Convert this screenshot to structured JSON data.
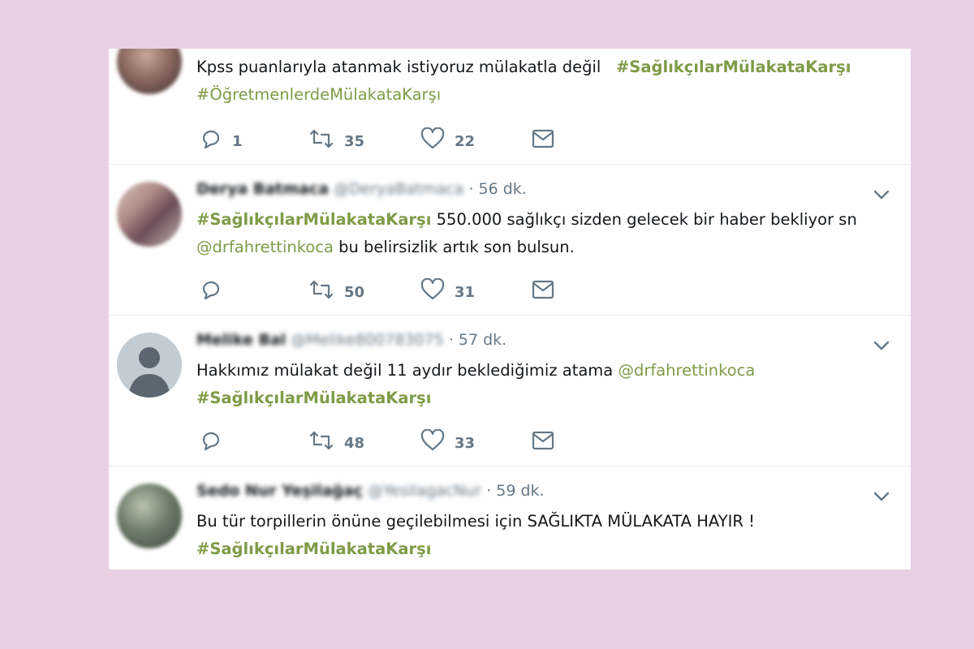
{
  "accent_color": "#7e9b46",
  "tweets": [
    {
      "text_plain": "Kpss puanlarıyla atanmak istiyoruz mülakatla değil",
      "tag1": "#SağlıkçılarMülakataKarşı",
      "tag2": "#ÖğretmenlerdeMülakataKarşı",
      "reply_count": "1",
      "retweet_count": "35",
      "like_count": "22"
    },
    {
      "name": "Derya Batmaca",
      "handle": "@DeryaBatmaca",
      "time": "· 56 dk.",
      "tag": "#SağlıkçılarMülakataKarşı",
      "text_1": " 550.000 sağlıkçı sizden gelecek bir haber bekliyor sn",
      "mention": "@drfahrettinkoca",
      "text_2": " bu belirsizlik artık son bulsun.",
      "reply_count": "",
      "retweet_count": "50",
      "like_count": "31"
    },
    {
      "name": "Melike Bal",
      "handle": "@Melike800783075",
      "time": "· 57 dk.",
      "text_1": "Hakkımız mülakat değil 11 aydır beklediğimiz atama ",
      "mention": "@drfahrettinkoca",
      "tag": "#SağlıkçılarMülakataKarşı",
      "reply_count": "",
      "retweet_count": "48",
      "like_count": "33"
    },
    {
      "name": "Sedo Nur Yeşilağaç",
      "handle": "@YesilagacNur",
      "time": "· 59 dk.",
      "text_1": "Bu tür torpillerin önüne geçilebilmesi için SAĞLIKTA MÜLAKATA HAYIR !",
      "tag": "#SağlıkçılarMülakataKarşı"
    }
  ]
}
